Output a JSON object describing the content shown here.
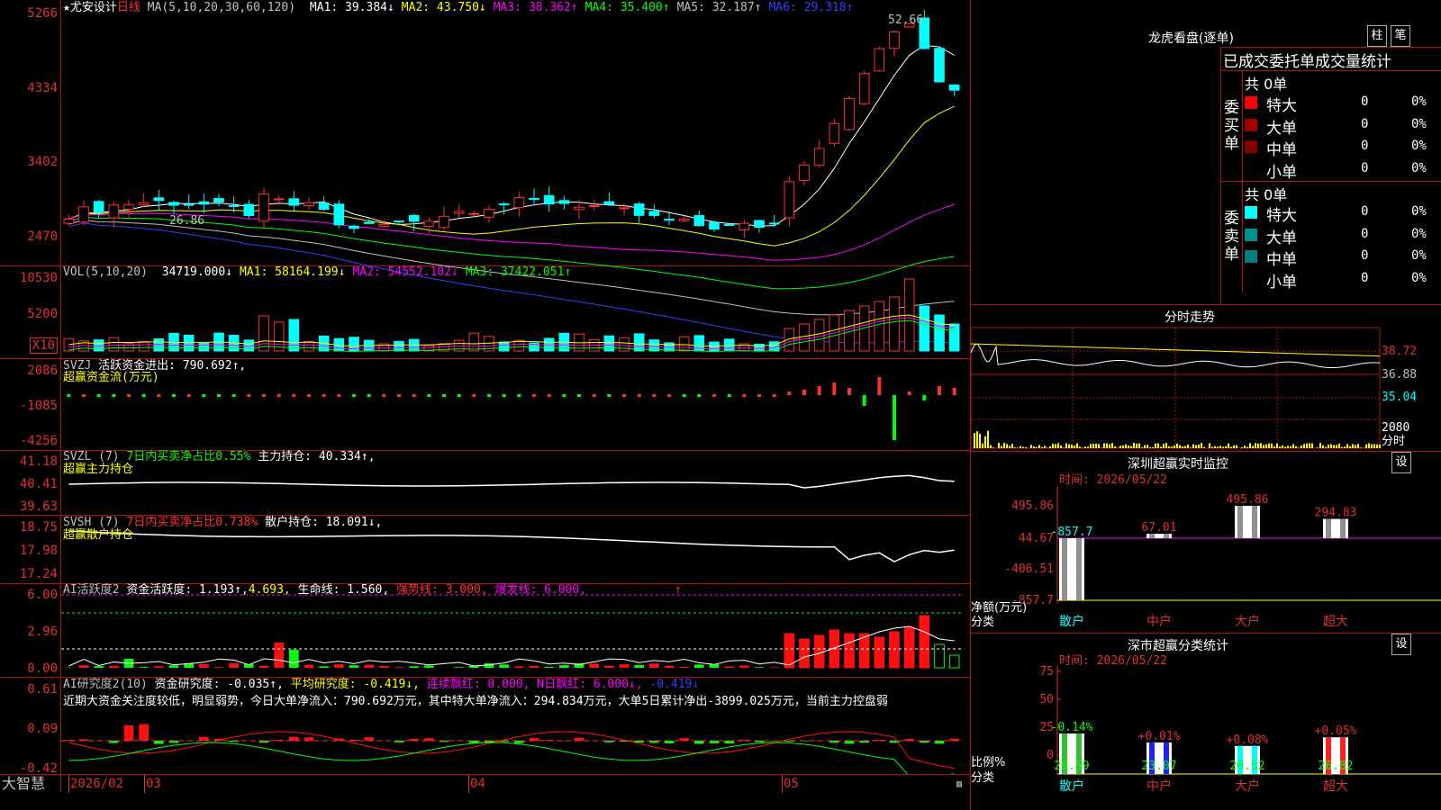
{
  "main_title": "★尤安设计",
  "period": "日线",
  "ma_line": {
    "params": "MA(5,10,20,30,60,120)",
    "items": [
      {
        "label": "MA1: 39.384↓",
        "color": "#ffffff"
      },
      {
        "label": "MA2: 43.750↓",
        "color": "#ffff00"
      },
      {
        "label": "MA3: 38.362↑",
        "color": "#ff00ff"
      },
      {
        "label": "MA4: 35.400↑",
        "color": "#00ff00"
      },
      {
        "label": "MA5: 32.187↑",
        "color": "#c0c0c0"
      },
      {
        "label": "MA6: 29.318↑",
        "color": "#3040ff"
      }
    ]
  },
  "price_axis": [
    "5266",
    "4334",
    "3402",
    "2470"
  ],
  "price_high_label": "52.66",
  "price_low_label": "26.86",
  "vol_line": {
    "params": "VOL(5,10,20)",
    "items": [
      {
        "label": "34719.000↓",
        "color": "#ffffff"
      },
      {
        "label": "MA1: 58164.199↓",
        "color": "#ffff00"
      },
      {
        "label": "MA2: 54552.102↓",
        "color": "#ff00ff"
      },
      {
        "label": "MA3: 37422.051↑",
        "color": "#00ff00"
      }
    ]
  },
  "vol_axis": [
    "10530",
    "5200"
  ],
  "vol_unit": "X10",
  "svzj": {
    "name": "SVZJ",
    "text": "活跃资金进出: 790.692↑,",
    "sub": "超赢资金流(万元)",
    "axis": [
      "2086",
      "-1085",
      "-4256"
    ]
  },
  "svzl": {
    "name": "SVZL (7)",
    "p1": "7日内买卖净占比0.55%",
    "p2": "主力持仓: 40.334↑,",
    "sub": "超赢主力持仓",
    "axis": [
      "41.18",
      "40.41",
      "39.63"
    ]
  },
  "svsh": {
    "name": "SVSH (7)",
    "p1": "7日内买卖净占比0.738%",
    "p2": "散户持仓: 18.091↓,",
    "sub": "超赢散户持仓",
    "axis": [
      "18.75",
      "17.98",
      "17.24"
    ]
  },
  "ai1": {
    "name": "AI活跃度2",
    "p1": "资金活跃度: 1.193↑,",
    "p2": "4.693,",
    "p3": "生命线: 1.560,",
    "p4": "强势线: 3.000,",
    "p5": "爆发线: 6.000,",
    "p6": "↑",
    "axis": [
      "6.00",
      "2.96",
      "0.00"
    ]
  },
  "ai2": {
    "name": "AI研究度2(10)",
    "p1": "资金研究度: -0.035↑,",
    "p2": "平均研究度: -0.419↓,",
    "p3": "连续飘红: 0.000,",
    "p4": "N日飘红: 6.000↓,",
    "p5": "-0.419↓",
    "axis": [
      "0.61",
      "0.09",
      "-0.42"
    ],
    "note": "近期大资金关注度较低，明显弱势，今日大单净流入：790.692万元，其中特大单净流入：294.834万元，大单5日累计净出-3899.025万元，当前主力控盘弱"
  },
  "bottom": {
    "logo": "大智慧",
    "dates": [
      "2026/02",
      "03",
      "04",
      "05"
    ]
  },
  "lhb": {
    "title": "龙虎看盘(逐单)",
    "btn1": "柱",
    "btn2": "笔",
    "tabs": [
      "已成交",
      "委托单",
      "成交量",
      "统计"
    ],
    "buy": {
      "side": "委买单",
      "count": "共 0单",
      "rows": [
        {
          "label": "特大",
          "val": "0",
          "pct": "0%",
          "color": "#ff0000"
        },
        {
          "label": "大单",
          "val": "0",
          "pct": "0%",
          "color": "#a00000"
        },
        {
          "label": "中单",
          "val": "0",
          "pct": "0%",
          "color": "#800000"
        },
        {
          "label": "小单",
          "val": "0",
          "pct": "0%",
          "color": ""
        }
      ]
    },
    "sell": {
      "side": "委卖单",
      "count": "共 0单",
      "rows": [
        {
          "label": "特大",
          "val": "0",
          "pct": "0%",
          "color": "#00ffff"
        },
        {
          "label": "大单",
          "val": "0",
          "pct": "0%",
          "color": "#009090"
        },
        {
          "label": "中单",
          "val": "0",
          "pct": "0%",
          "color": "#008080"
        },
        {
          "label": "小单",
          "val": "0",
          "pct": "0%",
          "color": ""
        }
      ]
    }
  },
  "fs": {
    "title": "分时走势",
    "axis": [
      "38.72",
      "36.88",
      "35.04"
    ],
    "vol_axis": "2080",
    "vol_unit": "分时"
  },
  "monitor": {
    "title": "深圳超赢实时监控",
    "btn": "设",
    "time": "时间: 2026/05/22",
    "axis": [
      "495.86",
      "44.67",
      "-406.51",
      "-857.7"
    ],
    "ylabel": "净额(万元)",
    "xlabel": "分类",
    "chart_data": {
      "type": "bar",
      "categories": [
        "散户",
        "中户",
        "大户",
        "超大"
      ],
      "values": [
        -857.7,
        67.01,
        495.86,
        294.83
      ],
      "labels": [
        "-857.7",
        "67.01",
        "495.86",
        "294.83"
      ],
      "ylim": [
        -857.7,
        495.86
      ]
    }
  },
  "stat": {
    "title": "深市超赢分类统计",
    "btn": "设",
    "time": "时间: 2026/05/22",
    "axis": [
      "75",
      "50",
      "25",
      "0"
    ],
    "ylabel": "比例%",
    "xlabel": "分类",
    "chart_data": {
      "type": "bar",
      "categories": [
        "散户",
        "中户",
        "大户",
        "超大"
      ],
      "values": [
        29.59,
        23.07,
        20.52,
        26.82
      ],
      "deltas": [
        "-0.14%",
        "+0.01%",
        "+0.08%",
        "+0.05%"
      ],
      "ylim": [
        0,
        75
      ]
    }
  }
}
